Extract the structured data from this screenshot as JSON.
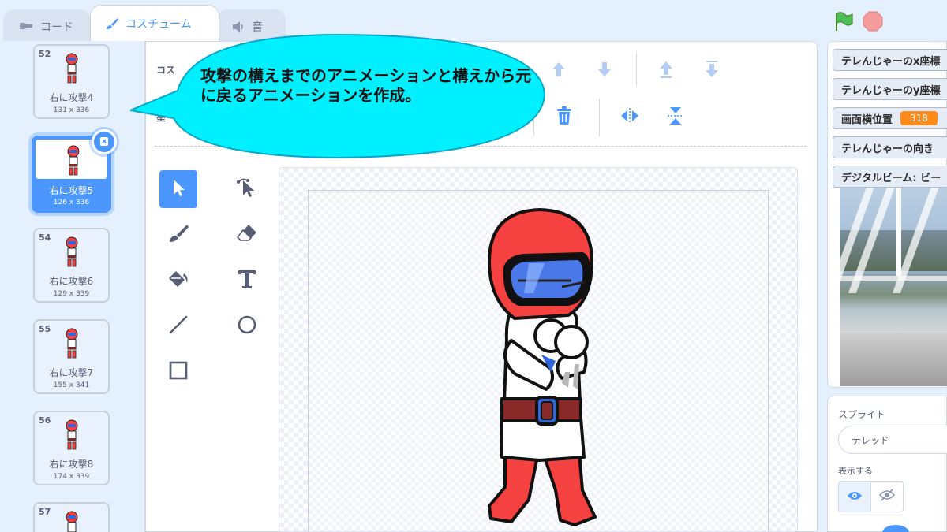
{
  "tabs": {
    "code": "コード",
    "costumes": "コスチューム",
    "sounds": "音"
  },
  "costumes": [
    {
      "num": "52",
      "name": "右に攻撃4",
      "size": "131 x 336"
    },
    {
      "num": "53",
      "name": "右に攻撃5",
      "size": "126 x 336",
      "selected": true
    },
    {
      "num": "54",
      "name": "右に攻撃6",
      "size": "129 x 339"
    },
    {
      "num": "55",
      "name": "右に攻撃7",
      "size": "155 x 341"
    },
    {
      "num": "56",
      "name": "右に攻撃8",
      "size": "174 x 339"
    },
    {
      "num": "57",
      "name": "",
      "size": ""
    }
  ],
  "editor": {
    "costume_label": "コス",
    "fill_label": "塗"
  },
  "callout": {
    "text": "攻撃の構えまでのアニメーションと構えから元に戻るアニメーションを作成。"
  },
  "monitors": [
    {
      "label": "テレんじゃーのx座標",
      "value": ""
    },
    {
      "label": "テレんじゃーのy座標",
      "value": ""
    },
    {
      "label": "画面横位置",
      "value": "318"
    },
    {
      "label": "テレんじゃーの向き",
      "value": ""
    },
    {
      "label": "デジタルビーム: ビー",
      "value": ""
    }
  ],
  "sprite_panel": {
    "sprite_label": "スプライト",
    "sprite_name": "テレッド",
    "show_label": "表示する"
  },
  "colors": {
    "accent": "#4c97ff",
    "callout": "#00f0ff",
    "monitor_value": "#ff8c1a",
    "hero_red": "#f5413f"
  }
}
